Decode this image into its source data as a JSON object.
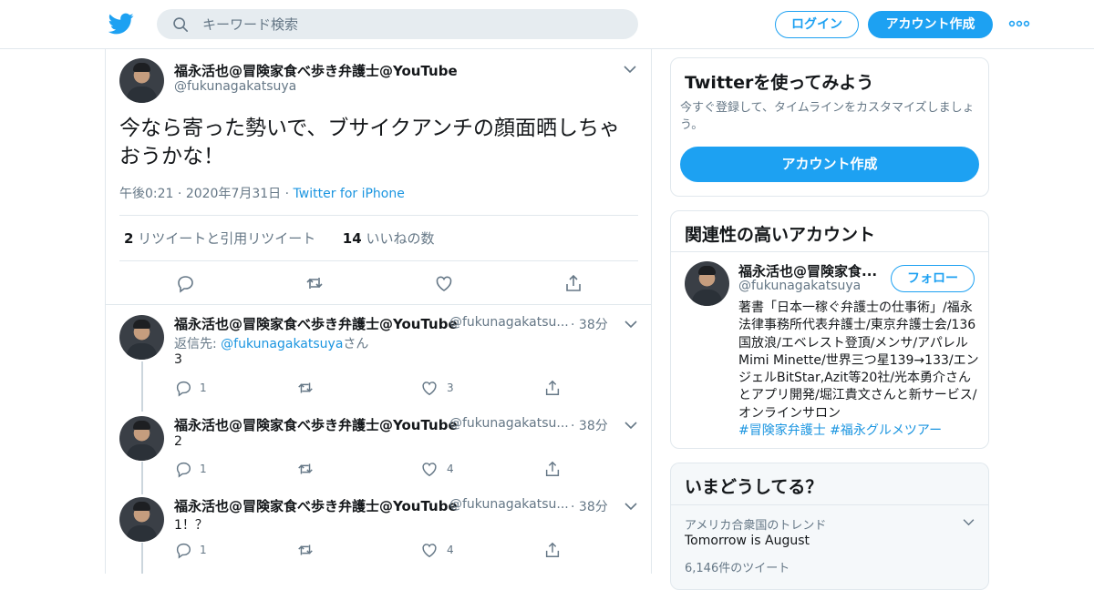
{
  "header": {
    "search_placeholder": "キーワード検索",
    "login_label": "ログイン",
    "signup_label": "アカウント作成"
  },
  "colors": {
    "accent": "#1da1f2",
    "link": "#1b95e0",
    "secondary_text": "#657786",
    "border": "#e1e8ed"
  },
  "focal_tweet": {
    "name": "福永活也@冒険家食べ歩き弁護士@YouTube",
    "handle": "@fukunagakatsuya",
    "text": "今なら寄った勢いで、ブサイクアンチの顔面晒しちゃおうかな！",
    "time": "午後0:21",
    "date": "2020年7月31日",
    "source": "Twitter for iPhone",
    "retweet_count": "2",
    "retweet_label": "リツイートと引用リツイート",
    "like_count": "14",
    "like_label": "いいねの数"
  },
  "replies": [
    {
      "name": "福永活也@冒険家食べ歩き弁護士@YouTube",
      "handle": "@fukunagakatsu...",
      "time": "38分",
      "reply_prefix": "返信先: ",
      "reply_mention": "@fukunagakatsuya",
      "reply_suffix": "さん",
      "text": "3",
      "reply_count": "1",
      "like_count": "3"
    },
    {
      "name": "福永活也@冒険家食べ歩き弁護士@YouTube",
      "handle": "@fukunagakatsu...",
      "time": "38分",
      "text": "2",
      "reply_count": "1",
      "like_count": "4"
    },
    {
      "name": "福永活也@冒険家食べ歩き弁護士@YouTube",
      "handle": "@fukunagakatsu...",
      "time": "38分",
      "text": "1！？",
      "reply_count": "1",
      "like_count": "4"
    }
  ],
  "signup_card": {
    "title": "Twitterを使ってみよう",
    "description": "今すぐ登録して、タイムラインをカスタマイズしましょう。",
    "button_label": "アカウント作成"
  },
  "related_card": {
    "title": "関連性の高いアカウント",
    "name": "福永活也@冒険家食...",
    "handle": "@fukunagakatsuya",
    "follow_label": "フォロー",
    "bio": "著書「日本一稼ぐ弁護士の仕事術」/福永法律事務所代表弁護士/東京弁護士会/136国放浪/エベレスト登頂/メンサ/アパレルMimi Minette/世界三つ星139→133/エンジェルBitStar,Azit等20社/光本勇介さんとアプリ開発/堀江貴文さんと新サービス/オンラインサロン",
    "tags": "#冒険家弁護士 #福永グルメツアー"
  },
  "trends_card": {
    "title": "いまどうしてる？",
    "category": "アメリカ合衆国のトレンド",
    "name": "Tomorrow is August",
    "count": "6,146件のツイート"
  }
}
